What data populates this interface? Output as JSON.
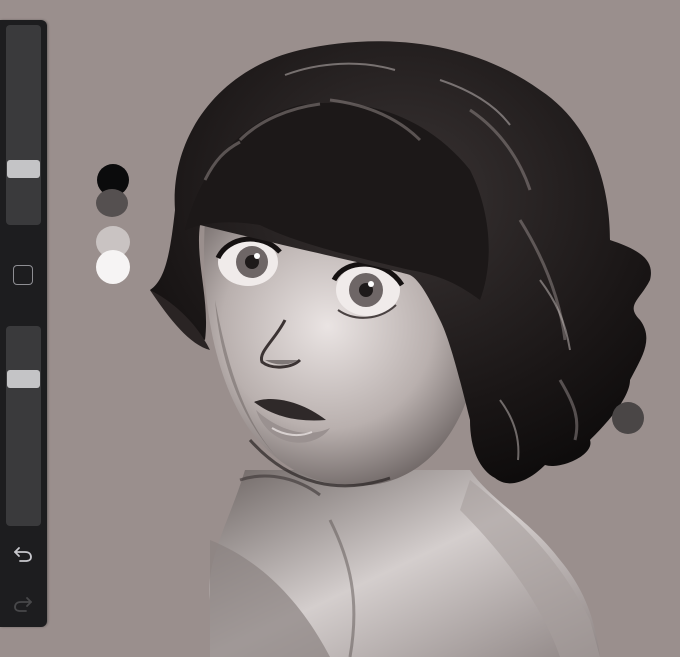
{
  "app": {
    "tool": "painting-canvas"
  },
  "toolbar": {
    "brush_size_level": 0.26,
    "opacity_level": 0.76,
    "modify_icon": "square-icon",
    "undo_icon": "undo-arrow-icon",
    "redo_icon": "redo-arrow-icon",
    "redo_enabled": false
  },
  "palette": {
    "swatches": [
      {
        "name": "black",
        "color": "#0b0b0c"
      },
      {
        "name": "dark-gray",
        "color": "#555050"
      },
      {
        "name": "light-gray",
        "color": "#c9c3c2"
      },
      {
        "name": "white",
        "color": "#f6f4f4"
      },
      {
        "name": "mid-gray",
        "color": "#4a4646"
      }
    ]
  },
  "colors": {
    "canvas_background": "#9a8f8d",
    "toolbar_background": "#1d1d1f",
    "slider_track": "#3a3a3c",
    "slider_thumb": "#c4c4c6"
  }
}
